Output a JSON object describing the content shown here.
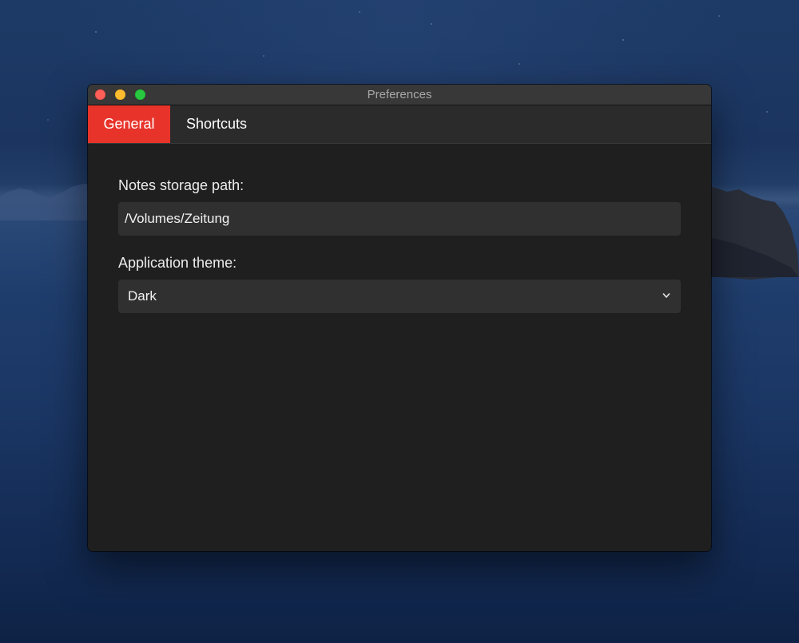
{
  "window": {
    "title": "Preferences"
  },
  "tabs": [
    {
      "label": "General",
      "active": true
    },
    {
      "label": "Shortcuts",
      "active": false
    }
  ],
  "general": {
    "storage_path_label": "Notes storage path:",
    "storage_path_value": "/Volumes/Zeitung",
    "theme_label": "Application theme:",
    "theme_value": "Dark"
  },
  "colors": {
    "accent": "#e8332a",
    "window_bg": "#1f1f1f",
    "input_bg": "#303030"
  },
  "icons": {
    "close": "close-icon",
    "minimize": "minimize-icon",
    "zoom": "zoom-icon",
    "dropdown": "chevron-down-icon"
  }
}
